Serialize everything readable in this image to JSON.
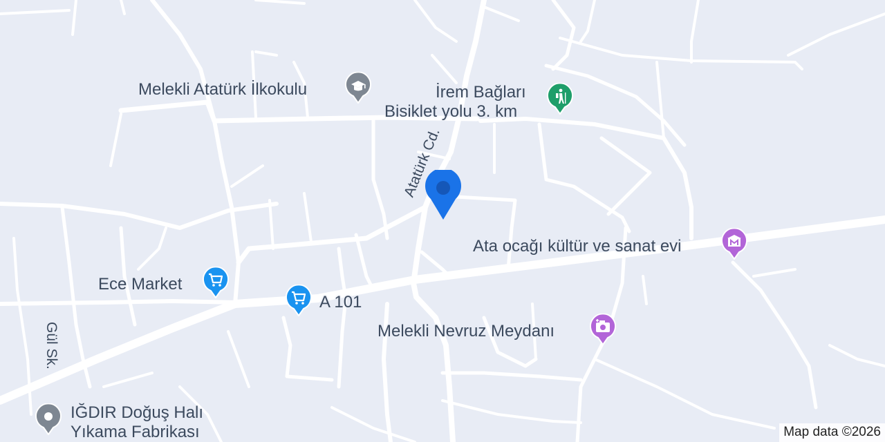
{
  "map": {
    "attribution": "Map data ©2026",
    "streets": {
      "ataturk": "Atatürk Cd.",
      "gul": "Gül Sk."
    },
    "pois": {
      "school": {
        "label": "Melekli Atatürk İlkokulu",
        "icon": "school-icon",
        "color": "#7e8792"
      },
      "bike": {
        "label_line1": "İrem Bağları",
        "label_line2": "Bisiklet yolu 3. km",
        "icon": "hiking-icon",
        "color": "#1e9e6a"
      },
      "culture": {
        "label": "Ata ocağı kültür ve sanat evi",
        "icon": "museum-icon",
        "color": "#b265d8"
      },
      "market_ece": {
        "label": "Ece Market",
        "icon": "shopping-cart-icon",
        "color": "#1a93f0"
      },
      "market_a101": {
        "label": "A 101",
        "icon": "shopping-cart-icon",
        "color": "#1a93f0"
      },
      "square": {
        "label": "Melekli Nevruz Meydanı",
        "icon": "camera-icon",
        "color": "#b265d8"
      },
      "factory": {
        "label_line1": "IĞDIR Doğuş Halı",
        "label_line2": "Yıkama Fabrikası",
        "icon": "generic-poi-icon",
        "color": "#7e8792"
      }
    },
    "marker": {
      "icon": "location-marker-icon",
      "color": "#1a73e8"
    }
  }
}
